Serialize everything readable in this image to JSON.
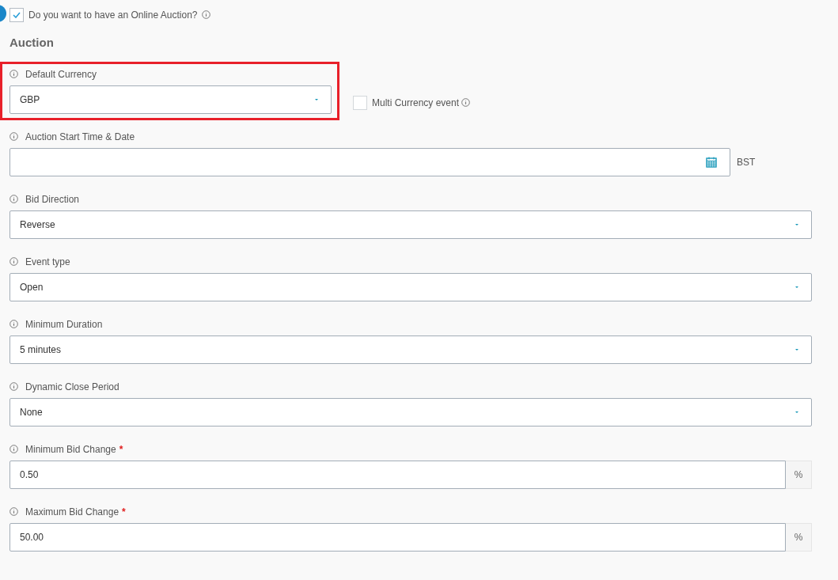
{
  "online_auction": {
    "label": "Do you want to have an Online Auction?",
    "checked": true
  },
  "section_title": "Auction",
  "fields": [
    {
      "kind": "select",
      "label": "Default Currency",
      "value": "GBP",
      "highlighted": true,
      "side_checkbox": {
        "label": "Multi Currency event",
        "checked": false
      }
    },
    {
      "kind": "date",
      "label": "Auction Start Time & Date",
      "highlighted": false,
      "suffix": "BST"
    },
    {
      "kind": "select",
      "label": "Bid Direction",
      "value": "Reverse",
      "highlighted": false
    },
    {
      "kind": "select",
      "label": "Event type",
      "value": "Open",
      "highlighted": false
    },
    {
      "kind": "select",
      "label": "Minimum Duration",
      "value": "5 minutes",
      "highlighted": false
    },
    {
      "kind": "select",
      "label": "Dynamic Close Period",
      "value": "None",
      "highlighted": false
    },
    {
      "kind": "number",
      "label": "Minimum Bid Change",
      "value": "0.50",
      "required_mark": "*",
      "highlighted": false,
      "addon": "%"
    },
    {
      "kind": "number",
      "label": "Maximum Bid Change",
      "value": "50.00",
      "required_mark": "*",
      "highlighted": false,
      "addon": "%"
    }
  ]
}
